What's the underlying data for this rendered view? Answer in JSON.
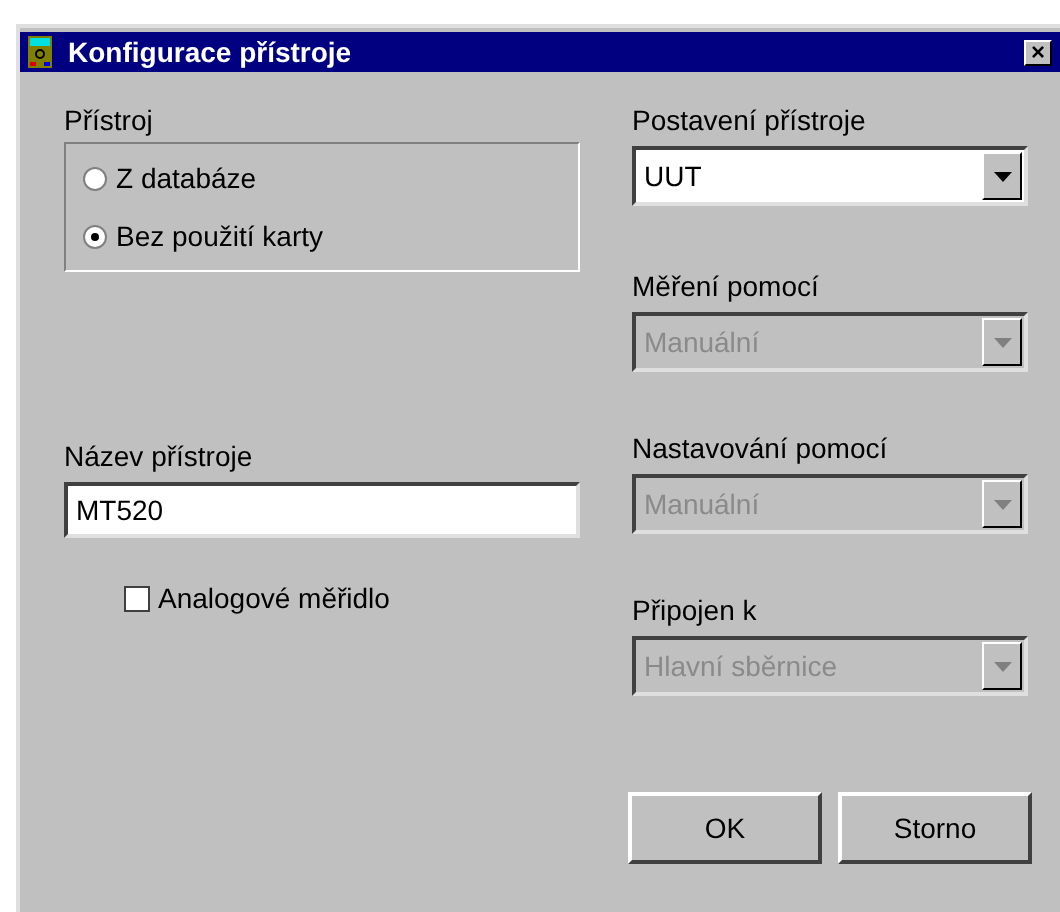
{
  "window": {
    "title": "Konfigurace přístroje",
    "close": "×"
  },
  "instrument_group": {
    "label": "Přístroj",
    "options": [
      {
        "label": "Z databáze",
        "selected": false
      },
      {
        "label": "Bez použití karty",
        "selected": true
      }
    ]
  },
  "name_field": {
    "label": "Název přístroje",
    "value": "MT520"
  },
  "analog_meter": {
    "label": "Analogové měřidlo",
    "checked": false
  },
  "dropdowns": [
    {
      "label": "Postavení přístroje",
      "value": "UUT",
      "disabled": false
    },
    {
      "label": "Měření pomocí",
      "value": "Manuální",
      "disabled": true
    },
    {
      "label": "Nastavování pomocí",
      "value": "Manuální",
      "disabled": true
    },
    {
      "label": "Připojen k",
      "value": "Hlavní sběrnice",
      "disabled": true
    }
  ],
  "buttons": [
    "OK",
    "Storno"
  ]
}
